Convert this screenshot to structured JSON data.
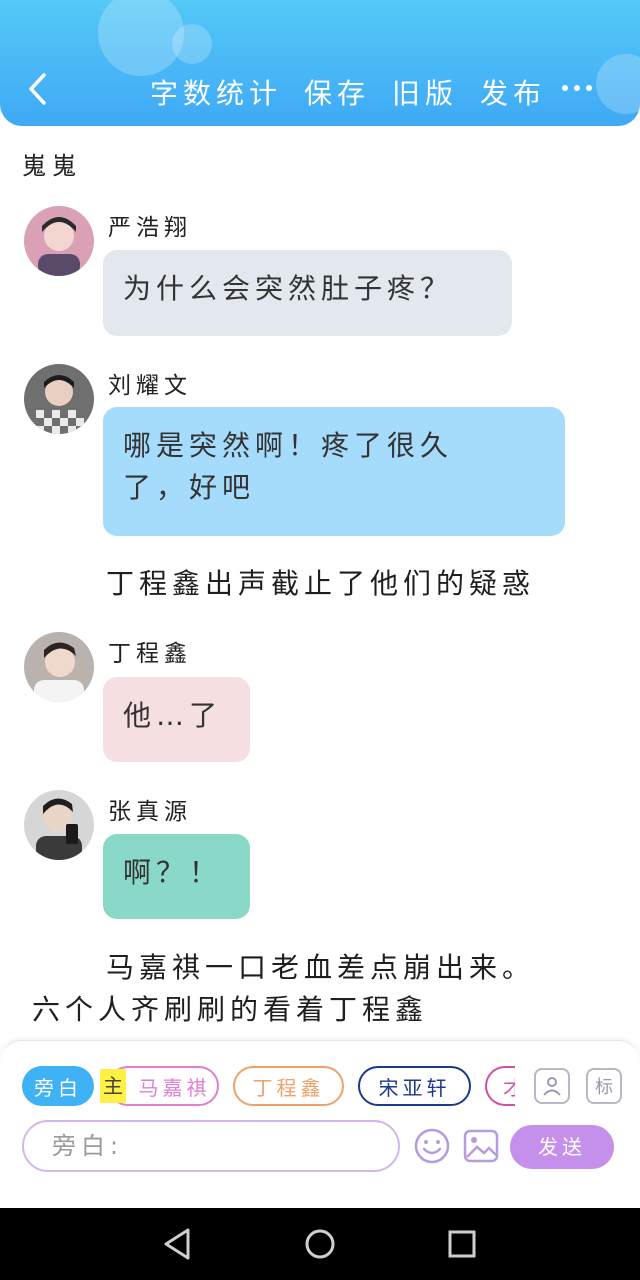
{
  "header": {
    "actions": [
      "字数统计",
      "保存",
      "旧版",
      "发布"
    ]
  },
  "chapter_title": "嵬嵬",
  "messages": [
    {
      "name": "严浩翔",
      "text": "为什么会突然肚子疼？"
    },
    {
      "name": "刘耀文",
      "text_line1": "哪是突然啊！疼了很久",
      "text_line2": "了，好吧"
    },
    {
      "name": "丁程鑫",
      "text": "他…了"
    },
    {
      "name": "张真源",
      "text": "啊？！"
    }
  ],
  "narrations": {
    "n1": "丁程鑫出声截止了他们的疑惑",
    "n2_line1": "马嘉祺一口老血差点崩出来。",
    "n2_line2": "六个人齐刷刷的看着丁程鑫"
  },
  "character_chips": {
    "active": "旁白",
    "main_badge": "主",
    "items": [
      "马嘉祺",
      "丁程鑫",
      "宋亚轩",
      "才"
    ],
    "tag_button": "标"
  },
  "composer": {
    "placeholder": "旁白:",
    "send_label": "发送"
  },
  "colors": {
    "header": "#3fa9f5",
    "bubble_yan": "#e3e7ee",
    "bubble_liu": "#a6dcfb",
    "bubble_ding": "#f5dfe0",
    "bubble_zhang": "#8ad9c8",
    "chip_active": "#3fb2f5",
    "chip_ma": "#e07fd0",
    "chip_ding": "#f0a06a",
    "chip_song": "#1a3a8c",
    "send": "#c490ec"
  },
  "icons": [
    "back-arrow-icon",
    "more-dots-icon",
    "contact-card-icon",
    "emoji-icon",
    "image-icon",
    "nav-back-icon",
    "nav-home-icon",
    "nav-recents-icon"
  ]
}
